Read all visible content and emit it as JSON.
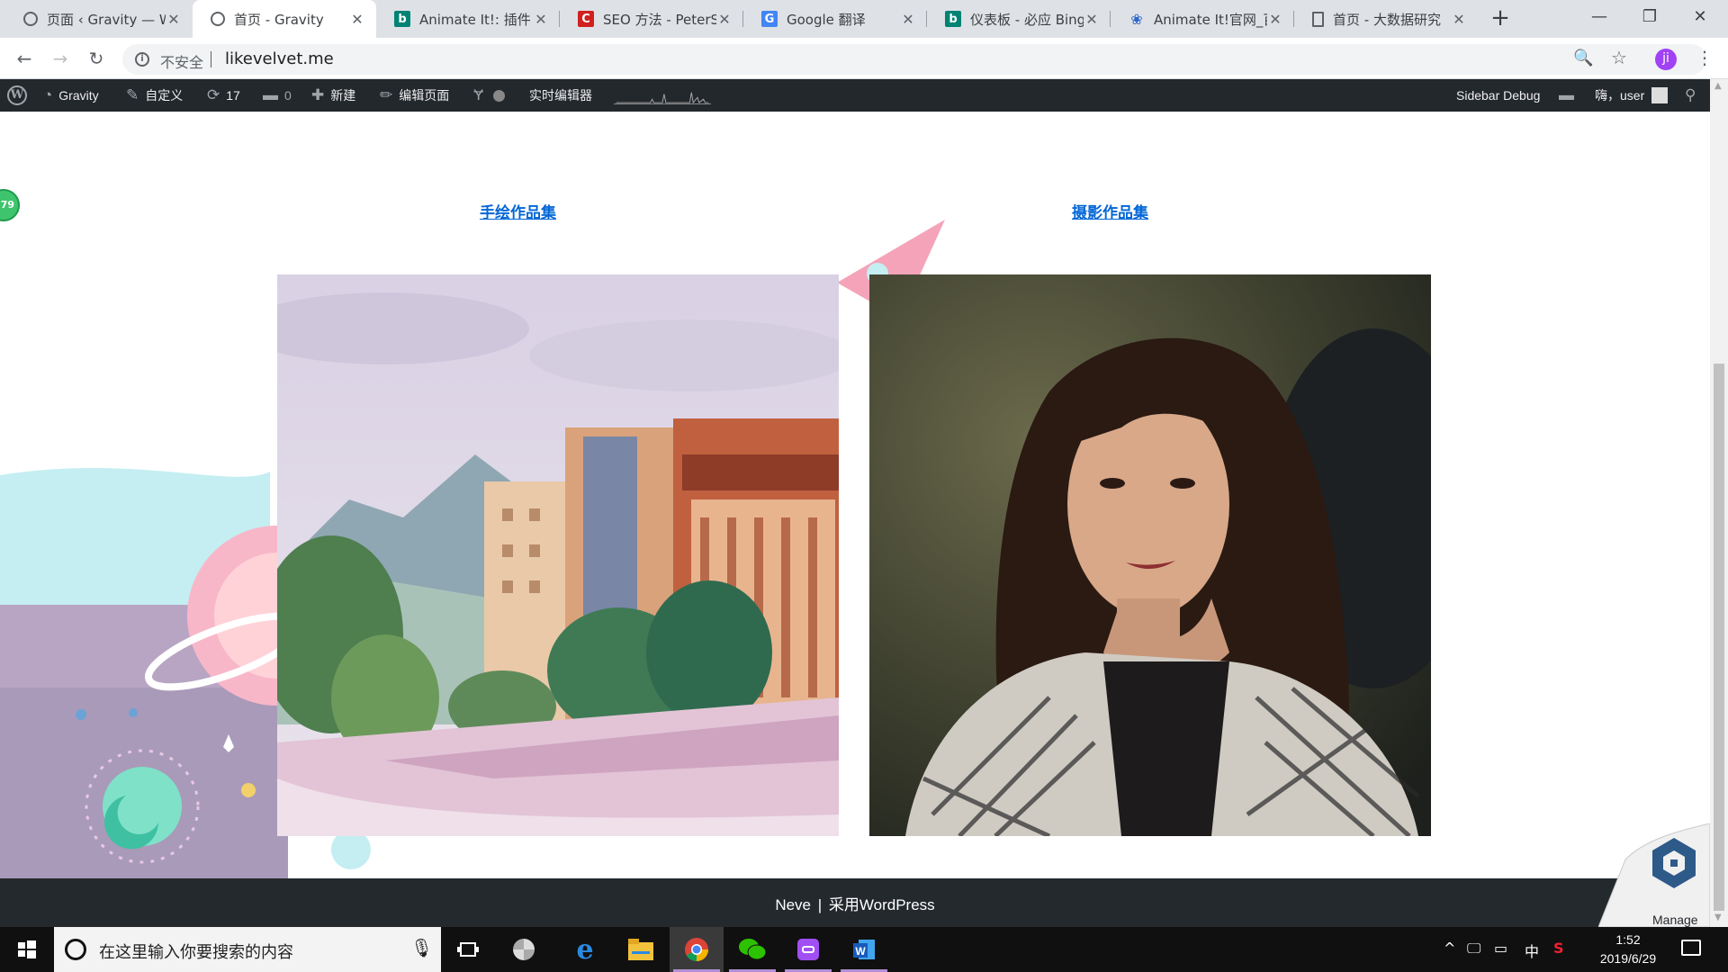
{
  "browser": {
    "tabs": [
      {
        "title": "页面 ‹ Gravity — W",
        "favicon": "globe-icon",
        "active": false
      },
      {
        "title": "首页 - Gravity",
        "favicon": "globe-icon",
        "active": true
      },
      {
        "title": "Animate It!: 插件",
        "favicon": "bing-icon",
        "active": false
      },
      {
        "title": "SEO 方法 - PeterS",
        "favicon": "seo-icon",
        "active": false
      },
      {
        "title": "Google 翻译",
        "favicon": "google-translate-icon",
        "active": false
      },
      {
        "title": "仪表板 - 必应 Bing",
        "favicon": "bing-icon",
        "active": false
      },
      {
        "title": "Animate It!官网_百",
        "favicon": "paw-icon",
        "active": false
      },
      {
        "title": "首页 - 大数据研究",
        "favicon": "document-icon",
        "active": false
      }
    ],
    "address": {
      "security_label": "不安全",
      "url": "likevelvet.me"
    },
    "profile_initial": "ji"
  },
  "admin_bar": {
    "site_name": "Gravity",
    "customize": "自定义",
    "updates_count": "17",
    "comments_count": "0",
    "new_label": "新建",
    "edit_page": "编辑页面",
    "live_editor": "实时编辑器",
    "sidebar_debug": "Sidebar Debug",
    "greeting": "嗨，user"
  },
  "page": {
    "links": {
      "hand_drawn": "手绘作品集",
      "photography": "摄影作品集"
    },
    "badge_number": "79"
  },
  "footer": {
    "theme": "Neve",
    "separator": "|",
    "powered_by": "采用WordPress",
    "manage_label": "Manage"
  },
  "taskbar": {
    "search_placeholder": "在这里输入你要搜索的内容",
    "time": "1:52",
    "date": "2019/6/29",
    "ime": "中"
  },
  "colors": {
    "admin_bar_bg": "#23282d",
    "link_blue": "#0366d6",
    "footer_bg": "#24292e",
    "taskbar_bg": "#101010"
  }
}
